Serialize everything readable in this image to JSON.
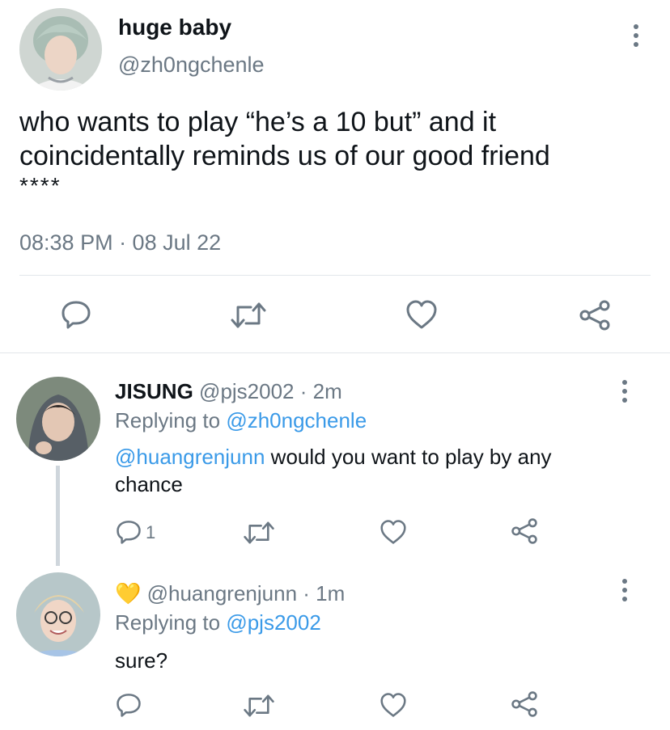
{
  "main_tweet": {
    "display_name": "huge baby",
    "handle": "@zh0ngchenle",
    "text_line1": "who wants to play “he’s a 10 but” and it",
    "text_line2": "coincidentally reminds us of our good friend",
    "text_line3": "****",
    "timestamp": "08:38 PM · 08 Jul 22"
  },
  "replies": [
    {
      "display_name": "JISUNG",
      "handle_time": "@pjs2002 · 2m",
      "replying_label": "Replying to",
      "replying_to": "@zh0ngchenle",
      "mention": "@huangrenjunn",
      "text_rest": " would you want to play by any",
      "text_line2": "chance",
      "reply_count": "1"
    },
    {
      "emoji": "💛",
      "handle_time": "@huangrenjunn · 1m",
      "replying_label": "Replying to",
      "replying_to": "@pjs2002",
      "text": "sure?",
      "reply_count": ""
    }
  ],
  "icons": {
    "reply": "reply-icon",
    "retweet": "retweet-icon",
    "like": "heart-icon",
    "share": "share-icon",
    "more": "more-icon"
  },
  "colors": {
    "link": "#3a9ae8",
    "muted": "#6b7884",
    "icon": "#6b7884",
    "heart_emoji": "#f7c948"
  }
}
